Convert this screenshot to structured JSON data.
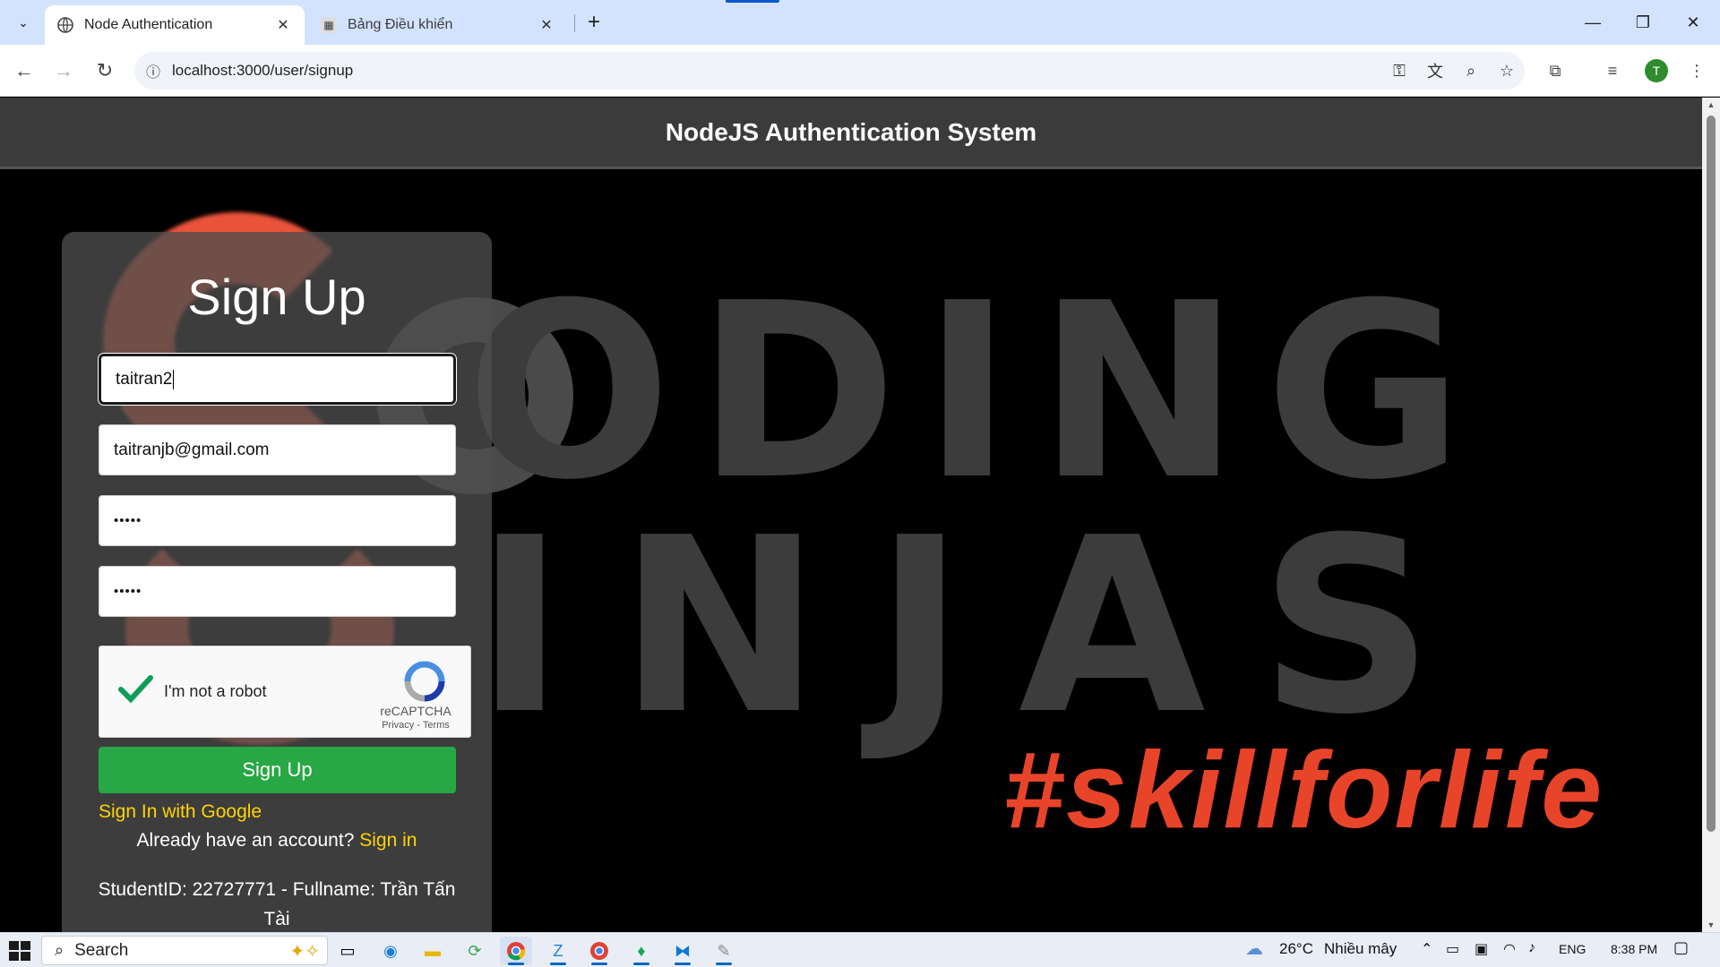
{
  "browser": {
    "tabs": [
      {
        "title": "Node Authentication",
        "active": true
      },
      {
        "title": "Bảng Điều khiển",
        "active": false
      }
    ],
    "url": "localhost:3000/user/signup",
    "profile_initial": "T"
  },
  "page": {
    "header_title": "NodeJS Authentication System",
    "background": {
      "line1": "ODING",
      "line2": "INJAS",
      "tagline": "#skillforlife"
    },
    "form": {
      "title": "Sign Up",
      "username_value": "taitran2",
      "email_value": "taitranjb@gmail.com",
      "password_value": "•••••",
      "confirm_password_value": "•••••",
      "captcha": {
        "label": "I'm not a robot",
        "brand": "reCAPTCHA",
        "links": "Privacy - Terms",
        "checked": true
      },
      "submit_label": "Sign Up",
      "google_link": "Sign In with Google",
      "have_account_text": "Already have an account?",
      "signin_link": "Sign in",
      "student_info": "StudentID: 22727771 - Fullname: Trần Tấn Tài"
    }
  },
  "taskbar": {
    "search_label": "Search",
    "weather": "26°C",
    "weather_desc": "Nhiều mây",
    "language": "ENG",
    "time": "8:38 PM"
  },
  "colors": {
    "header_bg": "#3b3b3b",
    "accent_green": "#28a745",
    "link_yellow": "#ffd400",
    "brand_orange": "#e8442a"
  }
}
